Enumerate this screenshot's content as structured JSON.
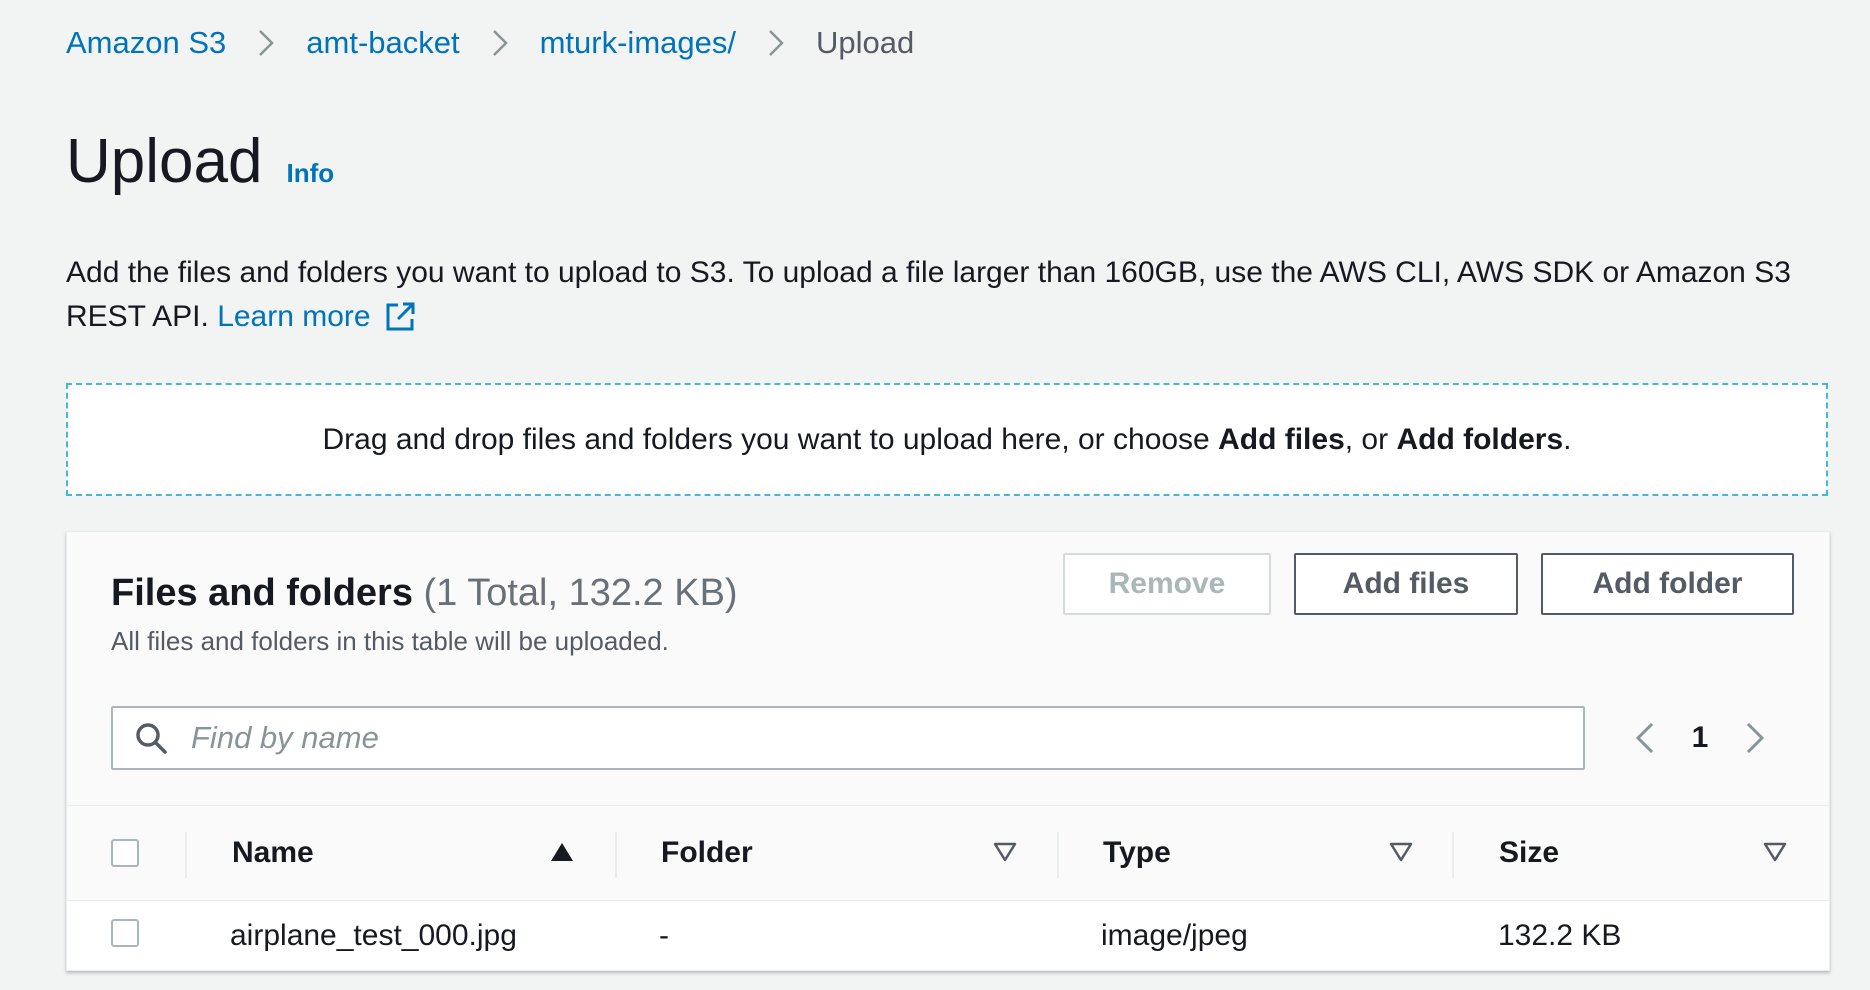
{
  "breadcrumb": {
    "items": [
      {
        "label": "Amazon S3"
      },
      {
        "label": "amt-backet"
      },
      {
        "label": "mturk-images/"
      },
      {
        "label": "Upload"
      }
    ]
  },
  "page": {
    "title": "Upload",
    "info_label": "Info",
    "description_text": "Add the files and folders you want to upload to S3. To upload a file larger than 160GB, use the AWS CLI, AWS SDK or Amazon S3 REST API.",
    "learn_more_label": "Learn more",
    "learn_more_icon": "external-link-icon"
  },
  "dropzone": {
    "text_before": "Drag and drop files and folders you want to upload here, or choose ",
    "add_files_emphasis": "Add files",
    "text_middle": ", or ",
    "add_folders_emphasis": "Add folders",
    "text_after": "."
  },
  "files_panel": {
    "title": "Files and folders",
    "count": "(1 Total, 132.2 KB)",
    "subtitle": "All files and folders in this table will be uploaded.",
    "buttons": {
      "remove": "Remove",
      "add_files": "Add files",
      "add_folder": "Add folder"
    },
    "search": {
      "placeholder": "Find by name",
      "value": ""
    },
    "pagination": {
      "current_page": "1"
    },
    "columns": [
      {
        "label": "Name",
        "sort": "ascending"
      },
      {
        "label": "Folder",
        "sort": "none"
      },
      {
        "label": "Type",
        "sort": "none"
      },
      {
        "label": "Size",
        "sort": "none"
      }
    ],
    "rows": [
      {
        "name": "airplane_test_000.jpg",
        "folder": "-",
        "type": "image/jpeg",
        "size": "132.2 KB"
      }
    ]
  },
  "colors": {
    "link": "#0073bb",
    "text": "#16191f",
    "muted": "#545b64",
    "dropzone_border": "#44b9d6",
    "background": "#f2f3f3"
  }
}
